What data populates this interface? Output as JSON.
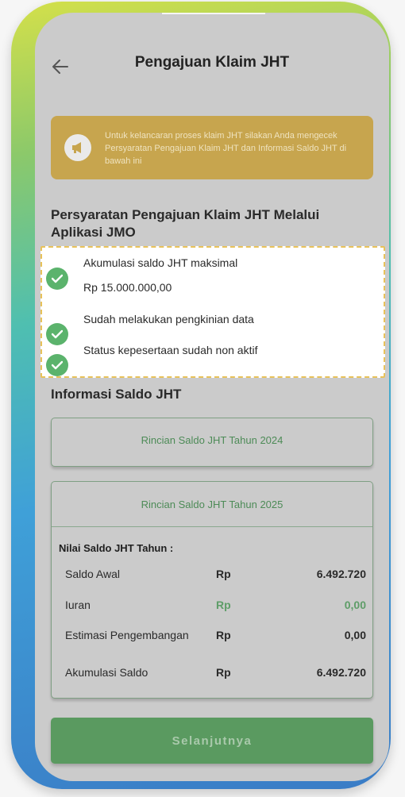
{
  "header": {
    "title": "Pengajuan Klaim JHT"
  },
  "banner": {
    "text": "Untuk kelancaran proses klaim JHT silakan Anda mengecek Persyaratan Pengajuan Klaim JHT dan Informasi Saldo JHT di bawah ini"
  },
  "requirements": {
    "title": "Persyaratan Pengajuan Klaim JHT Melalui Aplikasi JMO",
    "items": [
      {
        "line1": "Akumulasi saldo JHT maksimal",
        "line2": "Rp 15.000.000,00"
      },
      {
        "line1": "Sudah melakukan pengkinian data"
      },
      {
        "line1": "Status kepesertaan sudah non aktif"
      }
    ]
  },
  "saldo": {
    "title": "Informasi Saldo JHT",
    "card_2024": {
      "label": "Rincian Saldo JHT Tahun 2024"
    },
    "card_2025": {
      "label": "Rincian Saldo JHT Tahun 2025",
      "nilai_label": "Nilai Saldo JHT Tahun :",
      "rows": [
        {
          "label": "Saldo Awal",
          "currency": "Rp",
          "value": "6.492.720"
        },
        {
          "label": "Iuran",
          "currency": "Rp",
          "value": "0,00"
        },
        {
          "label": "Estimasi Pengembangan",
          "currency": "Rp",
          "value": "0,00"
        },
        {
          "label": "Akumulasi Saldo",
          "currency": "Rp",
          "value": "6.492.720"
        }
      ]
    }
  },
  "footer": {
    "next_label": "Selanjutnya"
  },
  "colors": {
    "accent_green": "#5bb36c",
    "banner_gold": "#c7a54e",
    "dashed_border": "#e8c25a"
  },
  "icons": {
    "back": "arrow-left-icon",
    "banner": "megaphone-icon",
    "check": "check-circle-icon"
  }
}
